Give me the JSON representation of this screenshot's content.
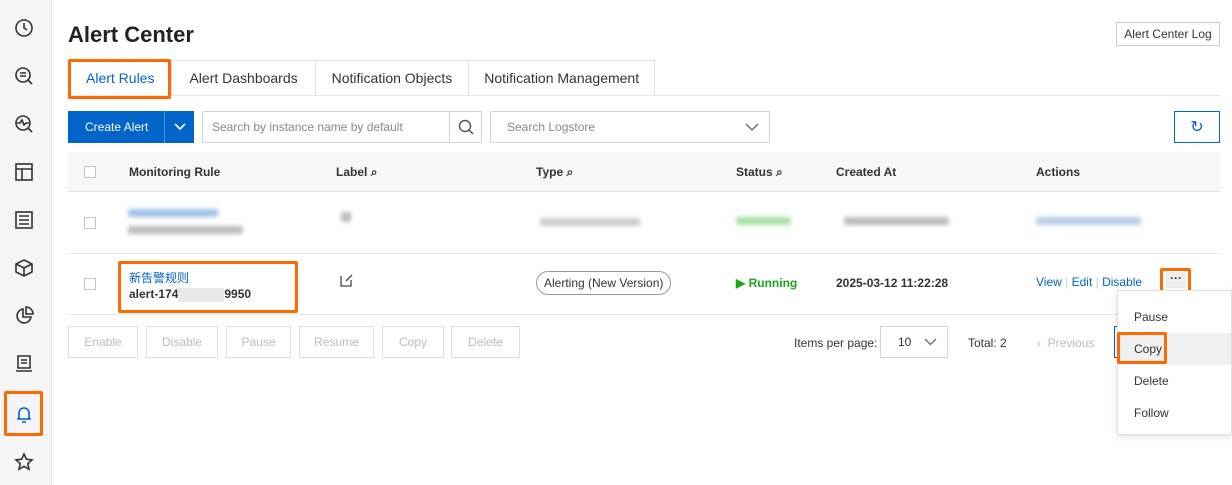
{
  "sidebar": {
    "items": [
      "clock-icon",
      "search-list-icon",
      "monitor-search-icon",
      "dashboard-icon",
      "list-icon",
      "cube-icon",
      "pie-chart-icon",
      "report-icon",
      "bell-icon",
      "star-icon"
    ],
    "active": "bell-icon"
  },
  "header": {
    "title": "Alert Center",
    "log_button": "Alert Center Log"
  },
  "tabs": [
    "Alert Rules",
    "Alert Dashboards",
    "Notification Objects",
    "Notification Management"
  ],
  "toolbar": {
    "create": "Create Alert",
    "search_placeholder": "Search by instance name by default",
    "logstore_placeholder": "Search Logstore"
  },
  "table": {
    "headers": [
      "Monitoring Rule",
      "Label",
      "Type",
      "Status",
      "Created At",
      "Actions"
    ],
    "rows": [
      {
        "name": "新告警规则",
        "id_prefix": "alert-174",
        "id_suffix": "9950",
        "type": "Alerting (New Version)",
        "status": "Running",
        "created": "2025-03-12 11:22:28",
        "actions": [
          "View",
          "Edit",
          "Disable"
        ]
      }
    ]
  },
  "bulk": [
    "Enable",
    "Disable",
    "Pause",
    "Resume",
    "Copy",
    "Delete"
  ],
  "pagination": {
    "per_page_label": "Items per page:",
    "per_page": "10",
    "total": "Total: 2",
    "previous": "Previous"
  },
  "menu": [
    "Pause",
    "Copy",
    "Delete",
    "Follow"
  ],
  "colors": {
    "accent": "#0064c8",
    "highlight": "#ff6a00",
    "running": "#1aa51a"
  }
}
